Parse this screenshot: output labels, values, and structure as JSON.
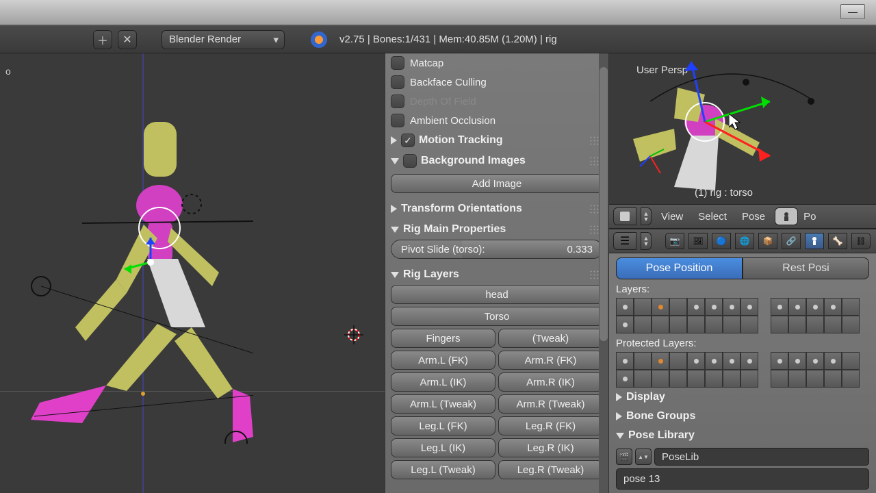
{
  "window": {
    "minimize": "—"
  },
  "toolbar": {
    "add_icon": "＋",
    "close_icon": "✕",
    "render_engine": "Blender Render",
    "status": "v2.75 | Bones:1/431 | Mem:40.85M (1.20M) | rig"
  },
  "viewport_main": {
    "perspective": "o"
  },
  "n_panel": {
    "shading": {
      "matcap": "Matcap",
      "backface": "Backface Culling",
      "dof": "Depth Of Field",
      "ao": "Ambient Occlusion"
    },
    "motion_tracking": "Motion Tracking",
    "bg_images": {
      "title": "Background Images",
      "add": "Add Image"
    },
    "transform_orient": "Transform Orientations",
    "rig_main": {
      "title": "Rig Main Properties",
      "pivot_label": "Pivot Slide (torso):",
      "pivot_value": "0.333"
    },
    "rig_layers": {
      "title": "Rig Layers",
      "head": "head",
      "torso": "Torso",
      "fingers": "Fingers",
      "tweak": "(Tweak)",
      "arm_l_fk": "Arm.L (FK)",
      "arm_r_fk": "Arm.R (FK)",
      "arm_l_ik": "Arm.L (IK)",
      "arm_r_ik": "Arm.R (IK)",
      "arm_l_tw": "Arm.L (Tweak)",
      "arm_r_tw": "Arm.R (Tweak)",
      "leg_l_fk": "Leg.L (FK)",
      "leg_r_fk": "Leg.R (FK)",
      "leg_l_ik": "Leg.L (IK)",
      "leg_r_ik": "Leg.R (IK)",
      "leg_l_tw": "Leg.L (Tweak)",
      "leg_r_tw": "Leg.R (Tweak)"
    }
  },
  "viewport_sec": {
    "persp": "User Persp",
    "object": "(1) rig : torso"
  },
  "header": {
    "view": "View",
    "select": "Select",
    "pose": "Pose",
    "po_truncated": "Po"
  },
  "armature": {
    "pose_position": "Pose Position",
    "rest_position": "Rest Posi",
    "layers_label": "Layers:",
    "protected_label": "Protected Layers:",
    "display": "Display",
    "bone_groups": "Bone Groups",
    "pose_library": "Pose Library",
    "poselib_name": "PoseLib",
    "pose_current": "pose 13"
  }
}
